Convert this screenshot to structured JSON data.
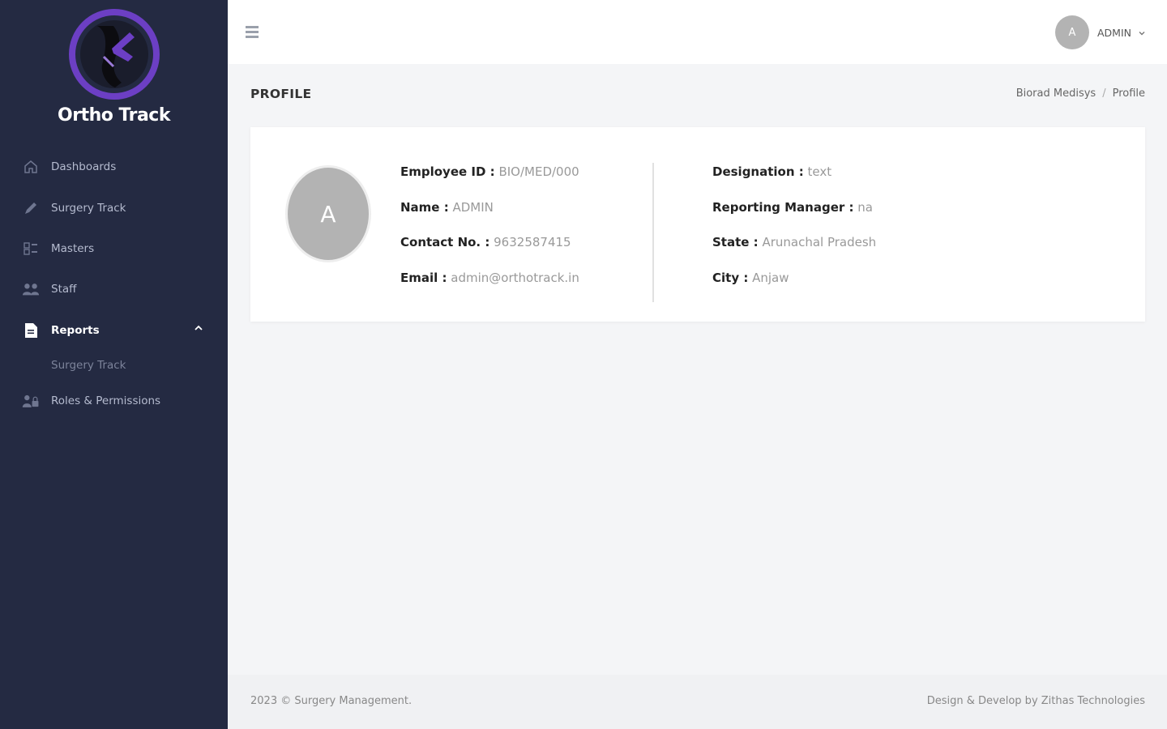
{
  "sidebar": {
    "brand": "Ortho Track",
    "items": [
      {
        "label": "Dashboards"
      },
      {
        "label": "Surgery Track"
      },
      {
        "label": "Masters"
      },
      {
        "label": "Staff"
      },
      {
        "label": "Reports"
      },
      {
        "label": "Roles & Permissions"
      }
    ],
    "subitems": [
      {
        "label": "Surgery Track"
      }
    ]
  },
  "topbar": {
    "avatar_initial": "A",
    "user_name": "ADMIN"
  },
  "page": {
    "title": "PROFILE",
    "breadcrumb": [
      "Biorad Medisys",
      "/",
      "Profile"
    ]
  },
  "profile": {
    "avatar_initial": "A",
    "left": [
      {
        "label": "Employee ID :",
        "value": "BIO/MED/000"
      },
      {
        "label": "Name :",
        "value": "ADMIN"
      },
      {
        "label": "Contact No. :",
        "value": "9632587415"
      },
      {
        "label": "Email :",
        "value": "admin@orthotrack.in"
      }
    ],
    "right": [
      {
        "label": "Designation :",
        "value": "text"
      },
      {
        "label": "Reporting Manager :",
        "value": "na"
      },
      {
        "label": "State :",
        "value": "Arunachal Pradesh"
      },
      {
        "label": "City :",
        "value": "Anjaw"
      }
    ]
  },
  "footer": {
    "left": "2023 © Surgery Management.",
    "right": "Design & Develop by Zithas Technologies"
  },
  "colors": {
    "sidebar_bg": "#242a42",
    "accent_purple": "#6c3fc4",
    "avatar_gray": "#b3b3b3"
  }
}
